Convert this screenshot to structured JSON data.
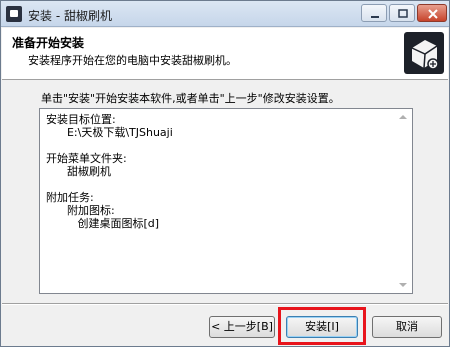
{
  "window": {
    "title": "安装 - 甜椒刷机"
  },
  "header": {
    "title": "准备开始安装",
    "subtitle": "安装程序开始在您的电脑中安装甜椒刷机。"
  },
  "main": {
    "instruction": "单击\"安装\"开始安装本软件,或者单击\"上一步\"修改安装设置。",
    "memo_lines": [
      "安装目标位置:",
      "      E:\\天极下载\\TJShuaji",
      "",
      "开始菜单文件夹:",
      "      甜椒刷机",
      "",
      "附加任务:",
      "      附加图标:",
      "         创建桌面图标[d]"
    ]
  },
  "buttons": {
    "back": "< 上一步[B]",
    "install": "安装[I]",
    "cancel": "取消"
  },
  "colors": {
    "highlight": "#e8141c",
    "titlebar": "#c6d6ea"
  }
}
